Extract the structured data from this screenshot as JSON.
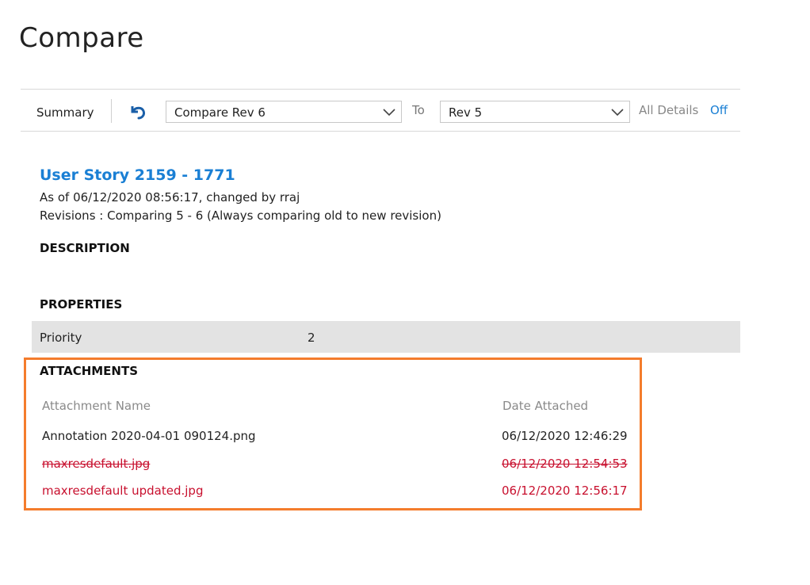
{
  "page": {
    "title": "Compare"
  },
  "toolbar": {
    "summary_label": "Summary",
    "from_revision": "Compare Rev 6",
    "to_label": "To",
    "to_revision": "Rev 5",
    "all_details_label": "All Details",
    "all_details_state": "Off"
  },
  "work_item": {
    "title": "User Story 2159 - 1771",
    "as_of": "As of 06/12/2020 08:56:17, changed by rraj",
    "revisions": "Revisions : Comparing 5 - 6 (Always comparing old to new revision)"
  },
  "sections": {
    "description": "DESCRIPTION",
    "properties": "PROPERTIES",
    "attachments": "ATTACHMENTS"
  },
  "properties": [
    {
      "name": "Priority",
      "value": "2"
    }
  ],
  "attachments": {
    "headers": {
      "name": "Attachment Name",
      "date": "Date Attached"
    },
    "rows": [
      {
        "name": "Annotation 2020-04-01 090124.png",
        "date": "06/12/2020 12:46:29",
        "status": "unchanged"
      },
      {
        "name": "maxresdefault.jpg",
        "date": "06/12/2020 12:54:53",
        "status": "deleted"
      },
      {
        "name": "maxresdefault updated.jpg",
        "date": "06/12/2020 12:56:17",
        "status": "added"
      }
    ]
  },
  "colors": {
    "accent": "#1a7fd4",
    "changed": "#c8102e",
    "highlight": "#f47c2c",
    "row_bg": "#e3e3e3"
  },
  "icons": {
    "undo": "undo-icon",
    "chevron": "chevron-down-icon"
  }
}
